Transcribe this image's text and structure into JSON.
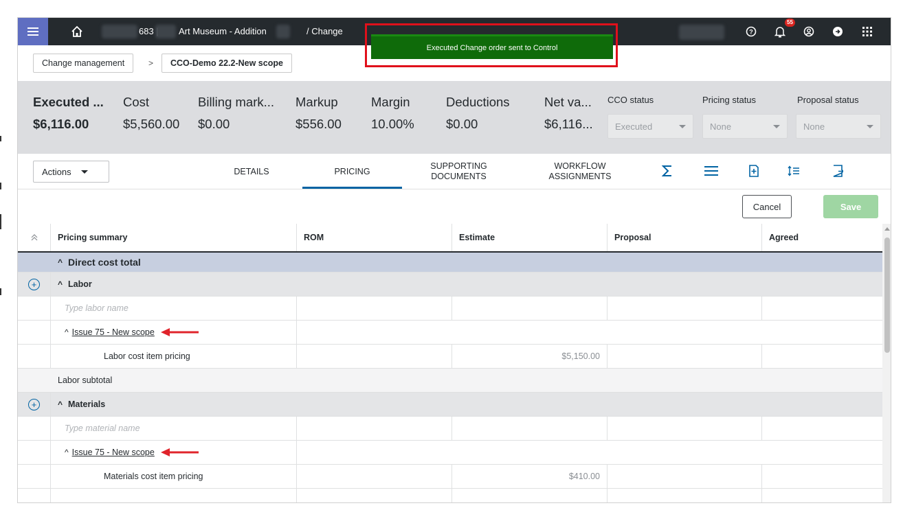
{
  "topbar": {
    "project_number": "683 |",
    "project_name": "Art Museum - Addition",
    "path_suffix": "/ Change",
    "notification_count": "55",
    "toast_message": "Executed Change order sent to Control"
  },
  "breadcrumb": {
    "items": [
      "Change management",
      "CCO-Demo 22.2-New scope"
    ],
    "separator": ">"
  },
  "summary": {
    "metrics": [
      {
        "label": "Executed ...",
        "value": "$6,116.00"
      },
      {
        "label": "Cost",
        "value": "$5,560.00"
      },
      {
        "label": "Billing mark...",
        "value": "$0.00"
      },
      {
        "label": "Markup",
        "value": "$556.00"
      },
      {
        "label": "Margin",
        "value": "10.00%"
      },
      {
        "label": "Deductions",
        "value": "$0.00"
      },
      {
        "label": "Net va...",
        "value": "$6,116..."
      }
    ],
    "statuses": [
      {
        "label": "CCO status",
        "value": "Executed"
      },
      {
        "label": "Pricing status",
        "value": "None"
      },
      {
        "label": "Proposal status",
        "value": "None"
      }
    ]
  },
  "tabs": {
    "actions_label": "Actions",
    "items": [
      "DETAILS",
      "PRICING",
      "SUPPORTING DOCUMENTS",
      "WORKFLOW ASSIGNMENTS"
    ],
    "active": "PRICING"
  },
  "buttons": {
    "cancel": "Cancel",
    "save": "Save"
  },
  "grid": {
    "columns": [
      "Pricing summary",
      "ROM",
      "Estimate",
      "Proposal",
      "Agreed"
    ],
    "rows": [
      {
        "text": "Direct cost total"
      },
      {
        "text": "Labor"
      },
      {
        "text": "Type labor name"
      },
      {
        "text": "Issue 75 - New scope"
      },
      {
        "text": "Labor cost item pricing",
        "estimate": "$5,150.00"
      },
      {
        "text": "Labor subtotal"
      },
      {
        "text": "Materials"
      },
      {
        "text": "Type material name"
      },
      {
        "text": "Issue 75 - New scope"
      },
      {
        "text": "Materials cost item pricing",
        "estimate": "$410.00"
      }
    ]
  },
  "colors": {
    "topbar": "#252a2e",
    "menu_accent": "#5f6ec1",
    "toast": "#0f6b0a",
    "highlight": "#e0101b",
    "link_blue": "#0063a3",
    "save_disabled": "#9fd6a3"
  }
}
